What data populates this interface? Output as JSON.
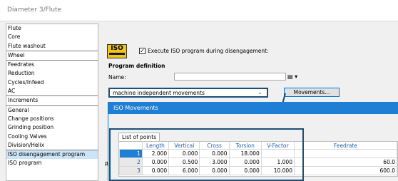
{
  "window": {
    "title": "Diameter 3/Flute"
  },
  "sidebar": {
    "items": [
      {
        "label": "Flute"
      },
      {
        "label": "Core"
      },
      {
        "label": "Flute washout"
      },
      {
        "label": "Wheel"
      },
      {
        "label": "Feedrates"
      },
      {
        "label": "Reduction"
      },
      {
        "label": "Cycles/Infeed"
      },
      {
        "label": "AC"
      },
      {
        "label": "Increments"
      },
      {
        "label": "General"
      },
      {
        "label": "Change positions"
      },
      {
        "label": "Grinding position"
      },
      {
        "label": "Cooling Valves"
      },
      {
        "label": "Division/Helix"
      },
      {
        "label": "ISO disengagement program"
      },
      {
        "label": "ISO program"
      }
    ],
    "selected_index": 14
  },
  "iso": {
    "logo_text": "ISO",
    "execute_checked": true,
    "execute_label": "Execute ISO program during disengagement:"
  },
  "program_definition": {
    "heading": "Program definition",
    "name_label": "Name:",
    "name_value": "",
    "movement_type": "machine independent movements",
    "movements_button": "Movements..."
  },
  "iso_movements": {
    "title": "ISO Movements",
    "tab_label": "List of points",
    "columns": [
      "",
      "Length",
      "Vertical",
      "Cross",
      "Torsion",
      "V-Factor",
      "Feedrate"
    ],
    "rows": [
      {
        "n": "1",
        "length": "2.000",
        "vertical": "0.000",
        "cross": "0.000",
        "torsion": "18.000",
        "vfactor": "",
        "feedrate": ""
      },
      {
        "n": "2",
        "length": "0.000",
        "vertical": "0.500",
        "cross": "3.000",
        "torsion": "0.000",
        "vfactor": "1.000",
        "feedrate": "60.0"
      },
      {
        "n": "3",
        "length": "0.000",
        "vertical": "6.000",
        "cross": "0.000",
        "torsion": "0.000",
        "vfactor": "10.000",
        "feedrate": "600.0"
      }
    ]
  },
  "partial_text": "R",
  "colors": {
    "accent": "#1f7fd4",
    "highlight_border": "#1b4f7a",
    "selected": "#cce4f7"
  }
}
